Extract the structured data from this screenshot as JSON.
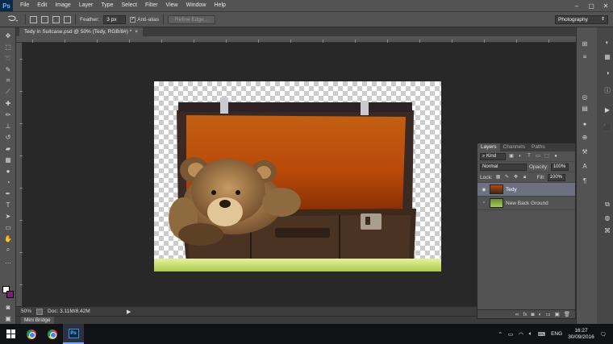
{
  "app": {
    "logo": "Ps",
    "menu": [
      "File",
      "Edit",
      "Image",
      "Layer",
      "Type",
      "Select",
      "Filter",
      "View",
      "Window",
      "Help"
    ],
    "window_controls": [
      "–",
      "▢",
      "✕"
    ]
  },
  "options_bar": {
    "feather_label": "Feather:",
    "feather_value": "3 px",
    "antialias_label": "Anti-alias",
    "antialias_checked": true,
    "refine_edge_label": "Refine Edge...",
    "workspace": "Photography"
  },
  "document_tab": {
    "title": "Tedy in Suitcase.psd @ 50% (Tedy, RGB/8#) *",
    "close": "×"
  },
  "status_bar": {
    "zoom": "50%",
    "doc_info": "Doc: 3.11M/8.42M"
  },
  "mini_bridge": {
    "label": "Mini Bridge"
  },
  "layers_panel": {
    "tabs": [
      "Layers",
      "Channels",
      "Paths"
    ],
    "kind_label": "Kind",
    "blend_mode": "Normal",
    "opacity_label": "Opacity:",
    "opacity_value": "100%",
    "lock_label": "Lock:",
    "fill_label": "Fill:",
    "fill_value": "100%",
    "layers": [
      {
        "name": "Tedy",
        "visible": true,
        "selected": true
      },
      {
        "name": "New Back Ground",
        "visible": false,
        "selected": false
      }
    ],
    "footer_icons": [
      "link-icon",
      "fx-icon",
      "mask-icon",
      "adjustment-icon",
      "group-icon",
      "new-layer-icon",
      "trash-icon"
    ]
  },
  "colors": {
    "foreground": "#ffffff",
    "background": "#7d1f78",
    "panel": "#535353",
    "canvas_bg": "#282828"
  },
  "taskbar": {
    "language": "ENG",
    "time": "16:27",
    "date": "30/09/2016",
    "apps": [
      "chrome",
      "chrome",
      "photoshop"
    ]
  }
}
